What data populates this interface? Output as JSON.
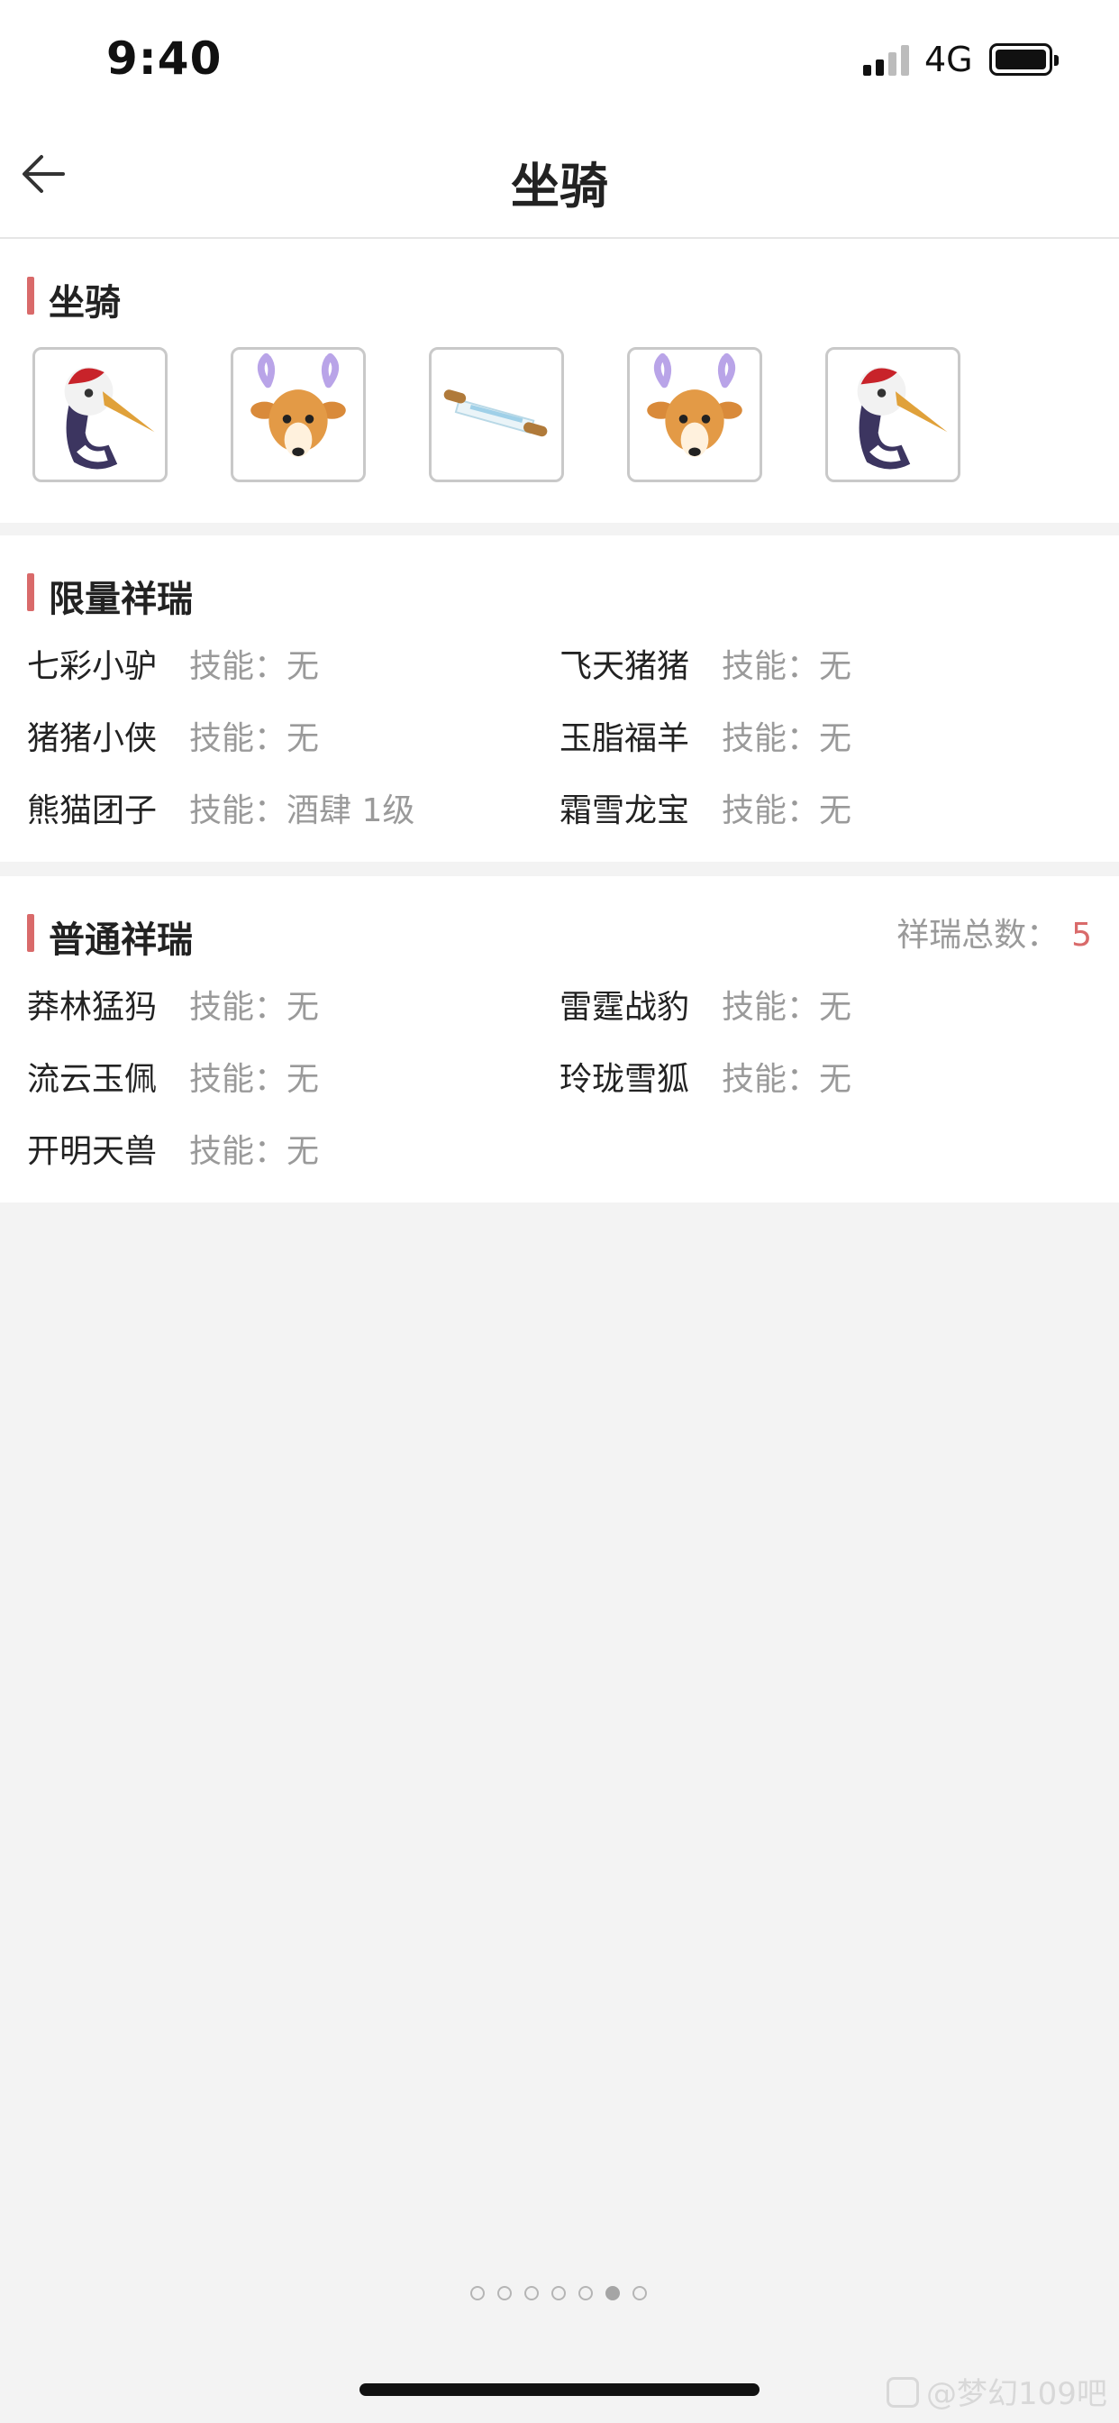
{
  "status_bar": {
    "time": "9:40",
    "network": "4G"
  },
  "nav": {
    "title": "坐骑",
    "back_icon": "arrow-left-icon"
  },
  "mounts_section": {
    "title": "坐骑",
    "items": [
      {
        "icon": "crane-mount-icon"
      },
      {
        "icon": "deer-mount-icon"
      },
      {
        "icon": "scroll-mount-icon"
      },
      {
        "icon": "deer-mount-icon"
      },
      {
        "icon": "crane-mount-icon"
      }
    ]
  },
  "limited_section": {
    "title": "限量祥瑞",
    "items": [
      {
        "name": "七彩小驴",
        "skill": "技能：无"
      },
      {
        "name": "飞天猪猪",
        "skill": "技能：无"
      },
      {
        "name": "猪猪小侠",
        "skill": "技能：无"
      },
      {
        "name": "玉脂福羊",
        "skill": "技能：无"
      },
      {
        "name": "熊猫团子",
        "skill": "技能：酒肆 1级"
      },
      {
        "name": "霜雪龙宝",
        "skill": "技能：无"
      }
    ]
  },
  "normal_section": {
    "title": "普通祥瑞",
    "total_label": "祥瑞总数：",
    "total_value": "5",
    "items": [
      {
        "name": "莽林猛犸",
        "skill": "技能：无"
      },
      {
        "name": "雷霆战豹",
        "skill": "技能：无"
      },
      {
        "name": "流云玉佩",
        "skill": "技能：无"
      },
      {
        "name": "玲珑雪狐",
        "skill": "技能：无"
      },
      {
        "name": "开明天兽",
        "skill": "技能：无"
      }
    ]
  },
  "pagination": {
    "total": 7,
    "active_index": 5
  },
  "watermark": "@梦幻109吧",
  "colors": {
    "accent": "#d96a6a",
    "background": "#f3f3f3",
    "muted_text": "#9a9a9a"
  }
}
